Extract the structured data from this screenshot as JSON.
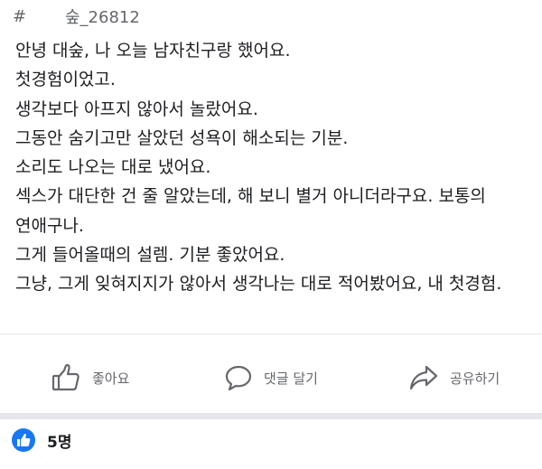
{
  "header": {
    "hash": "#",
    "tag": "숲_26812"
  },
  "post": {
    "lines": [
      "안녕 대숲, 나 오늘 남자친구랑 했어요.",
      "첫경험이었고.",
      "생각보다 아프지 않아서 놀랐어요.",
      "그동안 숨기고만 살았던 성욕이 해소되는 기분.",
      "소리도 나오는 대로 냈어요.",
      "섹스가 대단한 건 줄 알았는데, 해 보니 별거 아니더라구요. 보통의 연애구나.",
      "그게 들어올때의 설렘. 기분 좋았어요.",
      "그냥, 그게 잊혀지지가 않아서 생각나는 대로 적어봤어요, 내 첫경험."
    ]
  },
  "actions": {
    "like": "좋아요",
    "comment": "댓글 달기",
    "share": "공유하기"
  },
  "reactions": {
    "count": "5명"
  },
  "colors": {
    "accent": "#1877f2",
    "muted": "#65676b",
    "text": "#1c1e21"
  },
  "icons": {
    "like": "thumbs-up-icon",
    "comment": "speech-bubble-icon",
    "share": "share-arrow-icon",
    "reaction": "like-reaction-icon"
  }
}
